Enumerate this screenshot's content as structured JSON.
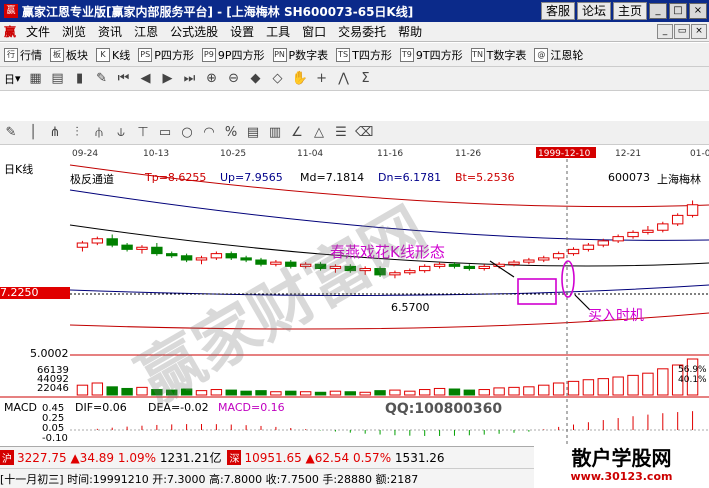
{
  "window": {
    "title": "赢家江恩专业版[赢家内部服务平台] - [上海梅林   SH600073-65日K线]",
    "buttons": [
      "客服",
      "论坛",
      "主页"
    ],
    "controls": [
      "_",
      "□",
      "×"
    ]
  },
  "menu": {
    "items": [
      "文件",
      "浏览",
      "资讯",
      "江恩",
      "公式选股",
      "设置",
      "工具",
      "窗口",
      "交易委托",
      "帮助"
    ],
    "window_controls": [
      "_",
      "▭",
      "×"
    ]
  },
  "toolbar1": {
    "items": [
      {
        "icon": "行",
        "label": "行情"
      },
      {
        "icon": "板",
        "label": "板块"
      },
      {
        "icon": "K",
        "label": "K线"
      },
      {
        "icon": "PS",
        "label": "P四方形"
      },
      {
        "icon": "P9",
        "label": "9P四方形"
      },
      {
        "icon": "PN",
        "label": "P数字表"
      },
      {
        "icon": "TS",
        "label": "T四方形"
      },
      {
        "icon": "T9",
        "label": "9T四方形"
      },
      {
        "icon": "TN",
        "label": "T数字表"
      },
      {
        "icon": "@",
        "label": "江恩轮"
      }
    ]
  },
  "toolbar2": {
    "period_label": "日"
  },
  "chart_data": {
    "type": "candlestick",
    "period": "日K线",
    "dates": [
      "09-24",
      "10-13",
      "10-25",
      "11-04",
      "11-16",
      "11-26",
      "1999-12-10",
      "12-21",
      "01-0"
    ],
    "indicator": {
      "name": "极反通道",
      "Tp": "Tp=8.6255",
      "Up": "Up=7.9565",
      "Md": "Md=7.1814",
      "Dn": "Dn=6.1781",
      "Bt": "Bt=5.2536"
    },
    "stock_code": "600073",
    "stock_name": "上海梅林",
    "price_label": "7.2250",
    "low_mark": "6.5700",
    "annotation_pattern": "春燕戏花K线形态",
    "annotation_buy": "买入时机",
    "price_axis": [
      "5.0002"
    ],
    "volume_axis": [
      "66139",
      "44092",
      "22046"
    ],
    "volume_pct": [
      "56.9%",
      "40.1%"
    ],
    "macd": {
      "label": "MACD",
      "DIF": "DIF=0.06",
      "DEA": "DEA=-0.02",
      "MACD": "MACD=0.16",
      "axis": [
        "0.45",
        "0.25",
        "0.05",
        "-0.10"
      ]
    },
    "candles": [
      [
        7.3,
        7.45,
        7.2,
        7.4
      ],
      [
        7.4,
        7.55,
        7.35,
        7.5
      ],
      [
        7.5,
        7.6,
        7.3,
        7.35
      ],
      [
        7.35,
        7.4,
        7.2,
        7.25
      ],
      [
        7.25,
        7.35,
        7.15,
        7.3
      ],
      [
        7.3,
        7.4,
        7.1,
        7.15
      ],
      [
        7.15,
        7.2,
        7.05,
        7.1
      ],
      [
        7.1,
        7.15,
        6.95,
        7.0
      ],
      [
        7.0,
        7.1,
        6.9,
        7.05
      ],
      [
        7.05,
        7.2,
        7.0,
        7.15
      ],
      [
        7.15,
        7.2,
        7.0,
        7.05
      ],
      [
        7.05,
        7.1,
        6.95,
        7.0
      ],
      [
        7.0,
        7.05,
        6.85,
        6.9
      ],
      [
        6.9,
        7.0,
        6.85,
        6.95
      ],
      [
        6.95,
        7.0,
        6.8,
        6.85
      ],
      [
        6.85,
        6.95,
        6.8,
        6.9
      ],
      [
        6.9,
        6.95,
        6.75,
        6.8
      ],
      [
        6.8,
        6.9,
        6.7,
        6.85
      ],
      [
        6.85,
        6.9,
        6.7,
        6.75
      ],
      [
        6.75,
        6.85,
        6.65,
        6.8
      ],
      [
        6.8,
        6.85,
        6.6,
        6.65
      ],
      [
        6.65,
        6.75,
        6.57,
        6.7
      ],
      [
        6.7,
        6.8,
        6.65,
        6.75
      ],
      [
        6.75,
        6.9,
        6.7,
        6.85
      ],
      [
        6.85,
        6.95,
        6.8,
        6.9
      ],
      [
        6.9,
        6.95,
        6.8,
        6.85
      ],
      [
        6.85,
        6.9,
        6.75,
        6.8
      ],
      [
        6.8,
        6.9,
        6.75,
        6.85
      ],
      [
        6.85,
        6.95,
        6.8,
        6.9
      ],
      [
        6.9,
        7.0,
        6.85,
        6.95
      ],
      [
        6.95,
        7.05,
        6.9,
        7.0
      ],
      [
        7.0,
        7.1,
        6.95,
        7.05
      ],
      [
        7.05,
        7.2,
        7.0,
        7.15
      ],
      [
        7.15,
        7.3,
        7.1,
        7.25
      ],
      [
        7.25,
        7.4,
        7.2,
        7.35
      ],
      [
        7.35,
        7.5,
        7.3,
        7.45
      ],
      [
        7.45,
        7.6,
        7.4,
        7.55
      ],
      [
        7.55,
        7.7,
        7.5,
        7.65
      ],
      [
        7.65,
        7.8,
        7.6,
        7.7
      ],
      [
        7.7,
        7.9,
        7.65,
        7.85
      ],
      [
        7.85,
        8.1,
        7.8,
        8.05
      ],
      [
        8.05,
        8.4,
        8.0,
        8.3
      ]
    ],
    "volumes": [
      18,
      22,
      15,
      12,
      14,
      10,
      9,
      11,
      8,
      10,
      9,
      7,
      8,
      6,
      7,
      6,
      5,
      7,
      6,
      5,
      8,
      9,
      7,
      10,
      12,
      11,
      9,
      10,
      13,
      14,
      15,
      18,
      22,
      25,
      28,
      30,
      33,
      36,
      40,
      48,
      55,
      66
    ]
  },
  "status": {
    "index1": {
      "badge": "沪",
      "value": "3227.75",
      "change": "▲34.89",
      "pct": "1.09%",
      "amount": "1231.21亿"
    },
    "index2": {
      "badge": "深",
      "value": "10951.65",
      "change": "▲62.54",
      "pct": "0.57%",
      "amount": "1531.26"
    },
    "info": "[十一月初三] 时间:19991210 开:7.3000 高:7.8000 收:7.7500 手:28880 额:2187"
  },
  "watermarks": {
    "qq": "QQ:100800360",
    "site_name": "散户学股网",
    "site_url": "www.30123.com"
  }
}
